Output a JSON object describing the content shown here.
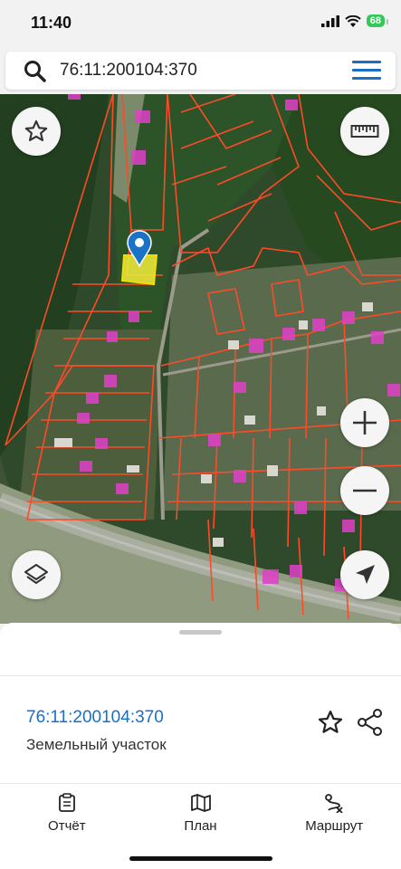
{
  "status_bar": {
    "time": "11:40",
    "battery": "68"
  },
  "search": {
    "query": "76:11:200104:370",
    "icon": "search-icon",
    "menu_icon": "hamburger-menu-icon"
  },
  "map": {
    "parcel_fill": "#f2ef3a",
    "boundary_color": "#ff4a2a",
    "marker_color": "#1a73c7",
    "controls": [
      "star-icon",
      "ruler-icon",
      "zoom-in-icon",
      "zoom-out-icon",
      "layers-icon",
      "locate-icon"
    ]
  },
  "details": {
    "cadastral_number": "76:11:200104:370",
    "object_type": "Земельный участок"
  },
  "tabs": [
    {
      "label": "Отчёт",
      "icon": "report-icon"
    },
    {
      "label": "План",
      "icon": "map-plan-icon"
    },
    {
      "label": "Маршрут",
      "icon": "route-icon"
    }
  ],
  "colors": {
    "accent": "#1a6fc4"
  }
}
